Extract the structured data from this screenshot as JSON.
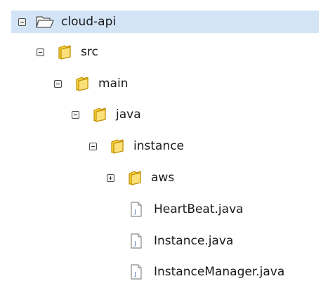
{
  "tree": {
    "root": {
      "label": "cloud-api",
      "state": "expanded",
      "icon": "folder-open-icon"
    },
    "src": {
      "label": "src",
      "state": "expanded",
      "icon": "folder-icon"
    },
    "main": {
      "label": "main",
      "state": "expanded",
      "icon": "folder-icon"
    },
    "java": {
      "label": "java",
      "state": "expanded",
      "icon": "folder-icon"
    },
    "instance": {
      "label": "instance",
      "state": "expanded",
      "icon": "folder-icon"
    },
    "aws": {
      "label": "aws",
      "state": "collapsed",
      "icon": "folder-icon"
    },
    "files": [
      {
        "label": "HeartBeat.java",
        "icon": "java-file-icon"
      },
      {
        "label": "Instance.java",
        "icon": "java-file-icon"
      },
      {
        "label": "InstanceManager.java",
        "icon": "java-file-icon"
      }
    ]
  },
  "colors": {
    "selection": "#d4e4f7",
    "folder": "#f5c518",
    "folder_outline": "#b8860b"
  }
}
